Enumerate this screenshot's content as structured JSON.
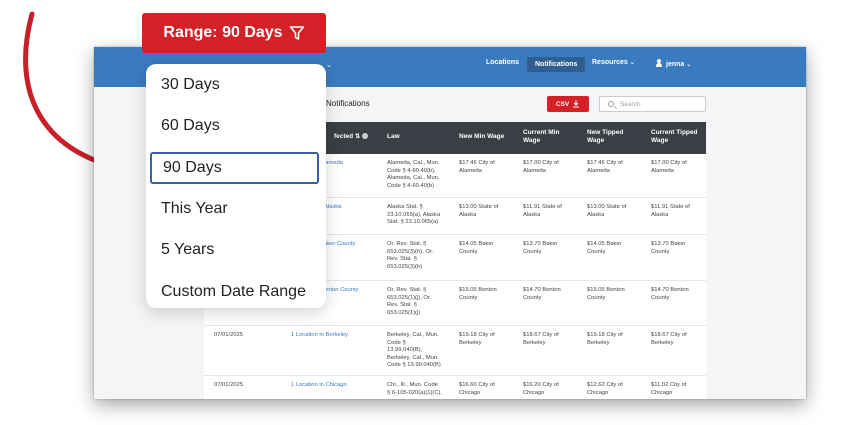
{
  "header": {
    "nav": [
      "Locations",
      "Notifications",
      "Resources",
      "jenna"
    ],
    "active_nav": "Notifications"
  },
  "page": {
    "title": "Notifications",
    "csv_label": "CSV",
    "search_placeholder": "Search"
  },
  "table": {
    "columns": [
      "fected",
      "Law",
      "New Min Wage",
      "Current Min Wage",
      "New Tipped Wage",
      "Current Tipped Wage"
    ],
    "rows": [
      {
        "date": "",
        "location": "lameda",
        "law": "Alameda, Cal., Mun.\nCode § 4-60.40(b),\nAlameda, Cal., Mun.\nCode § 4-60.40(b)",
        "new_min": "$17.46 City of\nAlameda",
        "cur_min": "$17.00 City of\nAlameda",
        "new_tip": "$17.46 City of\nAlameda",
        "cur_tip": "$17.00 City of\nAlameda"
      },
      {
        "date": "",
        "location": "Alaska",
        "law": "Alaska Stat. §\n23.10.065(a), Alaska\nStat. § 23.10.065(a)",
        "new_min": "$13.00 State of\nAlaska",
        "cur_min": "$11.91 State of\nAlaska",
        "new_tip": "$13.00 State of\nAlaska",
        "cur_tip": "$11.91 State of\nAlaska"
      },
      {
        "date": "",
        "location": "aker County",
        "law": "Or. Rev. Stat. §\n653.025(3)(h), Or.\nRev. Stat. §\n653.025(3)(h)",
        "new_min": "$14.05 Baker\nCounty",
        "cur_min": "$13.70 Baker\nCounty",
        "new_tip": "$14.05 Baker\nCounty",
        "cur_tip": "$13.70 Baker\nCounty"
      },
      {
        "date": "",
        "location": "enton County",
        "law": "Or. Rev. Stat. §\n653.025(1)(j), Or.\nRev. Stat. §\n653.025(1)(j)",
        "new_min": "$15.05 Benton\nCounty",
        "cur_min": "$14.70 Benton\nCounty",
        "new_tip": "$15.05 Benton\nCounty",
        "cur_tip": "$14.70 Benton\nCounty"
      },
      {
        "date": "07/01/2025",
        "location": "1 Location in Berkeley",
        "law": "Berkeley, Cal., Mun.\nCode §\n13.99.040(B),\nBerkeley, Cal., Mun.\nCode § 13.99.040(B)",
        "new_min": "$19.18 City of\nBerkeley",
        "cur_min": "$18.67 City of\nBerkeley",
        "new_tip": "$19.18 City of\nBerkeley",
        "cur_tip": "$18.67 City of\nBerkeley"
      },
      {
        "date": "07/01/2025",
        "location": "1 Location in Chicago",
        "law": "Chi., Ill., Mun. Code\n§ 6-105-020(a)(1)(C),",
        "new_min": "$16.60 City of\nChicago",
        "cur_min": "$16.20 City of\nChicago",
        "new_tip": "$12.62 City of\nChicago",
        "cur_tip": "$11.02 City of\nChicago"
      }
    ]
  },
  "range_button": {
    "label": "Range: 90 Days"
  },
  "range_menu": {
    "options": [
      "30 Days",
      "60 Days",
      "90 Days",
      "This Year",
      "5 Years",
      "Custom Date Range"
    ],
    "selected": "90 Days"
  },
  "colors": {
    "brand_red": "#d42027",
    "nav_blue": "#3a7bbf",
    "arrow_red": "#c8202a",
    "selected_border": "#3a5fa8"
  },
  "icons": {
    "range_button": "filter-icon",
    "csv": "download-icon",
    "search": "search-icon",
    "user": "user-icon"
  }
}
